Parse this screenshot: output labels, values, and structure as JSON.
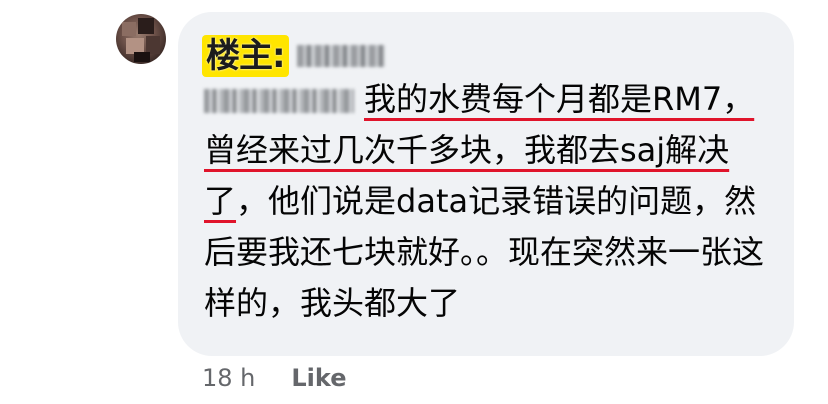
{
  "comment": {
    "owner_label": "楼主:",
    "text_segments": [
      {
        "text": "我的水费每个月都是RM7，曾经来过几次千多块，我都去saj解决了",
        "underlined": true
      },
      {
        "text": "，他们说是data记录错误的问题，然后要我还七块就好。。现在突然来一张这样的，我头都大了",
        "underlined": false
      }
    ],
    "timestamp": "18 h",
    "like_label": "Like"
  },
  "colors": {
    "bubble_bg": "#f0f2f5",
    "highlight": "#ffe500",
    "underline": "#e0142b",
    "meta_text": "#65676b"
  },
  "icons": [
    "avatar"
  ]
}
